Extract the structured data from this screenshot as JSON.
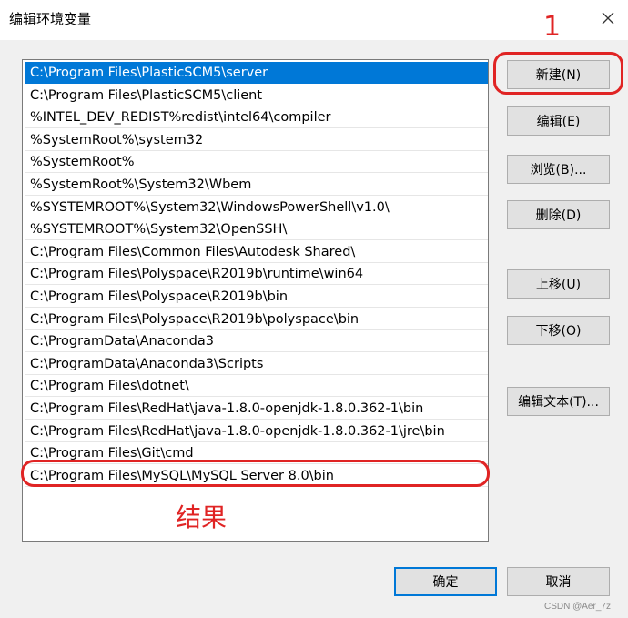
{
  "dialog": {
    "title": "编辑环境变量"
  },
  "path_list": {
    "items": [
      "C:\\Program Files\\PlasticSCM5\\server",
      "C:\\Program Files\\PlasticSCM5\\client",
      "%INTEL_DEV_REDIST%redist\\intel64\\compiler",
      "%SystemRoot%\\system32",
      "%SystemRoot%",
      "%SystemRoot%\\System32\\Wbem",
      "%SYSTEMROOT%\\System32\\WindowsPowerShell\\v1.0\\",
      "%SYSTEMROOT%\\System32\\OpenSSH\\",
      "C:\\Program Files\\Common Files\\Autodesk Shared\\",
      "C:\\Program Files\\Polyspace\\R2019b\\runtime\\win64",
      "C:\\Program Files\\Polyspace\\R2019b\\bin",
      "C:\\Program Files\\Polyspace\\R2019b\\polyspace\\bin",
      "C:\\ProgramData\\Anaconda3",
      "C:\\ProgramData\\Anaconda3\\Scripts",
      "C:\\Program Files\\dotnet\\",
      "C:\\Program Files\\RedHat\\java-1.8.0-openjdk-1.8.0.362-1\\bin",
      "C:\\Program Files\\RedHat\\java-1.8.0-openjdk-1.8.0.362-1\\jre\\bin",
      "C:\\Program Files\\Git\\cmd",
      "C:\\Program Files\\MySQL\\MySQL Server 8.0\\bin"
    ],
    "selected_index": 0
  },
  "buttons": {
    "new": "新建(N)",
    "edit": "编辑(E)",
    "browse": "浏览(B)...",
    "delete": "删除(D)",
    "move_up": "上移(U)",
    "move_down": "下移(O)",
    "edit_text": "编辑文本(T)...",
    "ok": "确定",
    "cancel": "取消"
  },
  "annotations": {
    "step_number": "1",
    "result_label": "结果",
    "color": "#e02424"
  },
  "watermark": "CSDN @Aer_7z",
  "colors": {
    "selection": "#0078d7",
    "dialog_bg": "#f0f0f0",
    "button_bg": "#e1e1e1"
  },
  "icons": {
    "close": "close-icon"
  }
}
